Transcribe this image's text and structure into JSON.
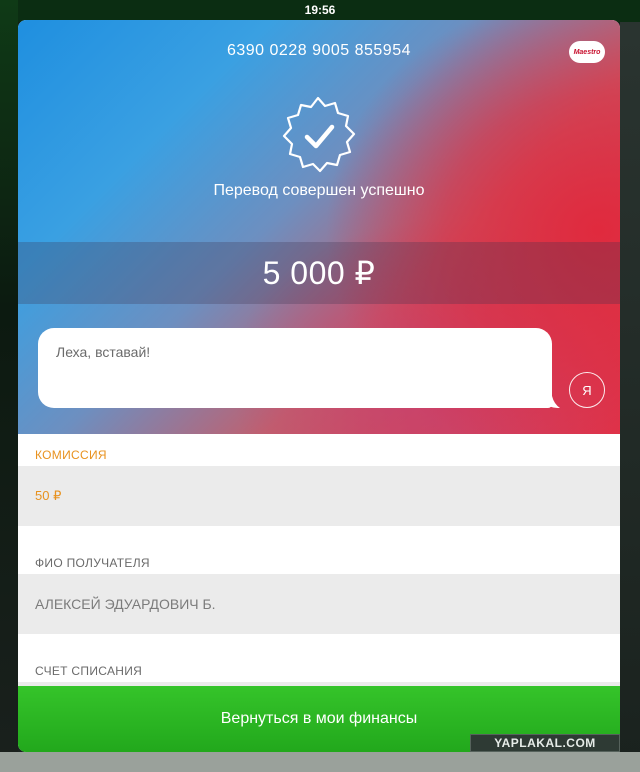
{
  "status_bar": {
    "time": "19:56"
  },
  "card": {
    "number": "6390 0228 9005 855954",
    "brand": "Maestro"
  },
  "result": {
    "message": "Перевод совершен успешно",
    "icon": "check-badge-icon"
  },
  "amount": "5 000 ₽",
  "comment": {
    "text": "Леха, вставай!",
    "avatar_letter": "Я"
  },
  "details": [
    {
      "label": "КОМИССИЯ",
      "value": "50 ₽"
    },
    {
      "label": "ФИО ПОЛУЧАТЕЛЯ",
      "value": "АЛЕКСЕЙ ЭДУАРДОВИЧ Б."
    },
    {
      "label": "СЧЕТ СПИСАНИЯ",
      "value": ""
    }
  ],
  "button": {
    "label": "Вернуться в мои финансы"
  },
  "watermark": "YAPLAKAL.COM",
  "colors": {
    "accent_orange": "#e8921f",
    "button_green": "#2ab522",
    "gradient_blue": "#1f8fe0",
    "gradient_red": "#e03349"
  }
}
